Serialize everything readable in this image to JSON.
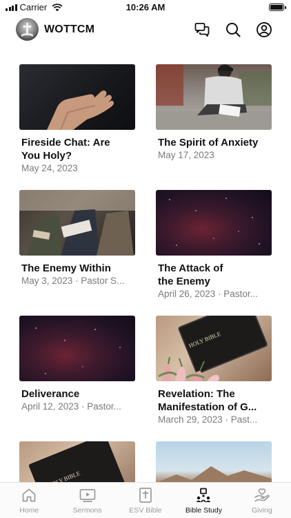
{
  "status_bar": {
    "carrier": "Carrier",
    "time": "10:26 AM",
    "icons": [
      "signal-icon",
      "wifi-icon",
      "battery-icon"
    ]
  },
  "header": {
    "title": "WOTTCM",
    "icons": [
      "chat-icon",
      "search-icon",
      "profile-icon"
    ]
  },
  "cards": [
    {
      "title": "Fireside Chat: Are\nYou Holy?",
      "meta": "May 24, 2023",
      "image": "open-hand-photo"
    },
    {
      "title": "The Spirit of Anxiety",
      "meta": "May 17, 2023",
      "image": "man-writing-photo"
    },
    {
      "title": "The Enemy Within",
      "meta": "May 3, 2023 · Pastor S...",
      "image": "group-bible-study-photo"
    },
    {
      "title": "The Attack of\nthe Enemy",
      "meta": "April 26, 2023 · Pastor...",
      "image": "night-sky-photo"
    },
    {
      "title": "Deliverance",
      "meta": "April 12, 2023 · Pastor...",
      "image": "night-sky-photo"
    },
    {
      "title": "Revelation: The\nManifestation of G...",
      "meta": "March 29, 2023 · Past...",
      "image": "holy-bible-tulips-photo"
    },
    {
      "title": "",
      "meta": "",
      "image": "holy-bible-photo"
    },
    {
      "title": "",
      "meta": "",
      "image": "desert-landscape-photo"
    }
  ],
  "bible_label": "HOLY BIBLE",
  "tabs": [
    {
      "label": "Home",
      "icon": "home-icon",
      "active": false
    },
    {
      "label": "Sermons",
      "icon": "video-icon",
      "active": false
    },
    {
      "label": "ESV Bible",
      "icon": "bible-icon",
      "active": false
    },
    {
      "label": "Bible Study",
      "icon": "bible-study-icon",
      "active": true
    },
    {
      "label": "Giving",
      "icon": "giving-icon",
      "active": false
    }
  ],
  "colors": {
    "active_tab": "#111111",
    "inactive_tab": "#9a9a9a",
    "meta_text": "#7a7a7a"
  }
}
